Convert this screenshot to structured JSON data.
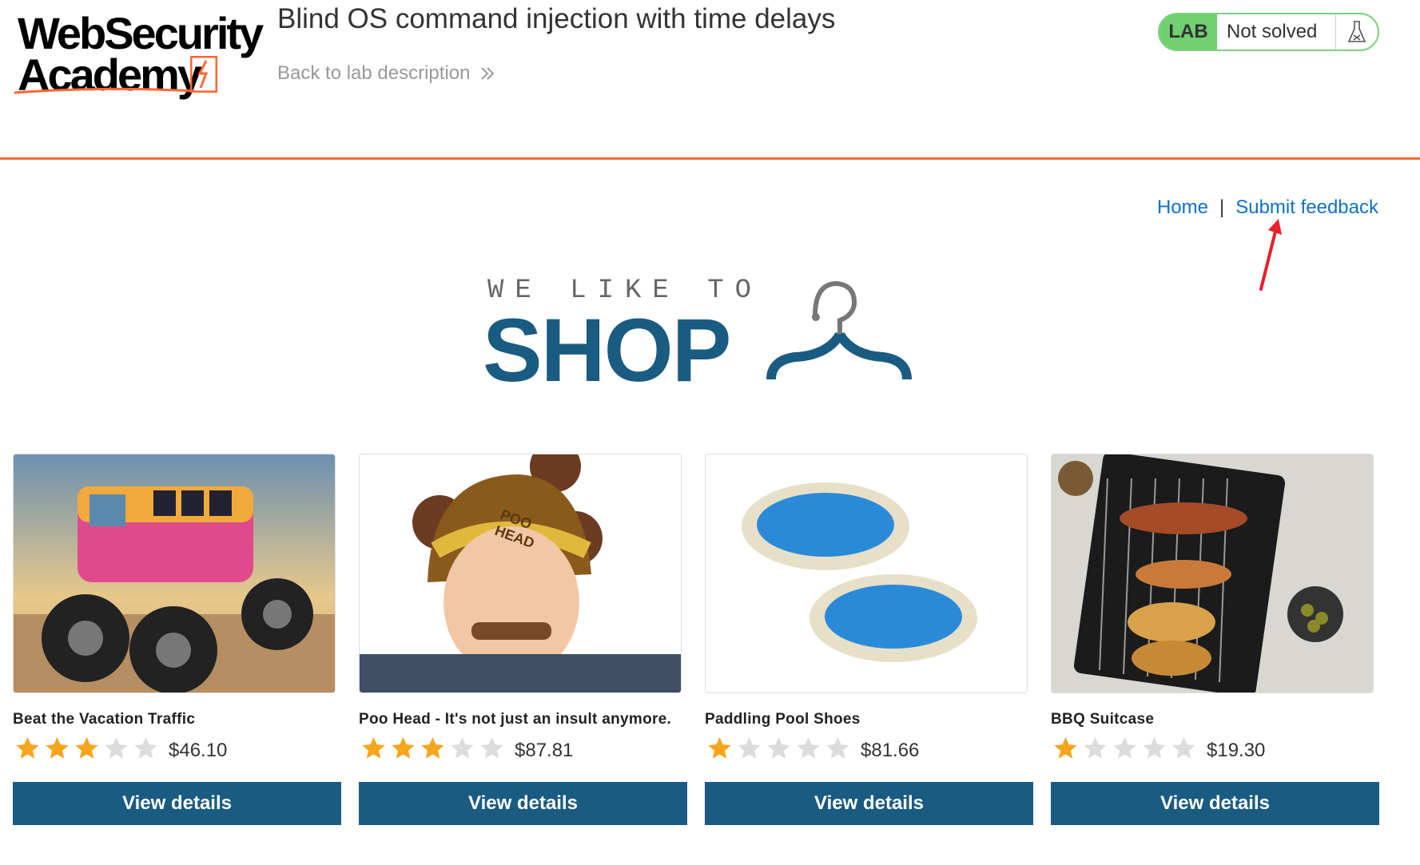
{
  "header": {
    "logo_line1": "WebSecurity",
    "logo_line2": "Academy",
    "lab_title": "Blind OS command injection with time delays",
    "back_link": "Back to lab description",
    "status_badge": "LAB",
    "status_text": "Not solved"
  },
  "nav": {
    "home": "Home",
    "separator": "|",
    "feedback": "Submit feedback"
  },
  "banner": {
    "tagline": "WE LIKE TO",
    "title": "SHOP"
  },
  "colors": {
    "accent_orange": "#ff6633",
    "brand_blue": "#1a5b82",
    "link_blue": "#1170c4",
    "lab_green": "#70d070",
    "star_gold": "#f7a51c",
    "star_empty": "#dcdcdc",
    "annotation_red": "#e8202a"
  },
  "products": [
    {
      "name": "Beat the Vacation Traffic",
      "rating": 3,
      "max_rating": 5,
      "price": "$46.10",
      "button": "View details",
      "image": "monster-van"
    },
    {
      "name": "Poo Head - It's not just an insult anymore.",
      "rating": 3,
      "max_rating": 5,
      "price": "$87.81",
      "button": "View details",
      "image": "poo-head-hat"
    },
    {
      "name": "Paddling Pool Shoes",
      "rating": 1,
      "max_rating": 5,
      "price": "$81.66",
      "button": "View details",
      "image": "paddling-pools"
    },
    {
      "name": "BBQ Suitcase",
      "rating": 1,
      "max_rating": 5,
      "price": "$19.30",
      "button": "View details",
      "image": "bbq-grill"
    }
  ]
}
